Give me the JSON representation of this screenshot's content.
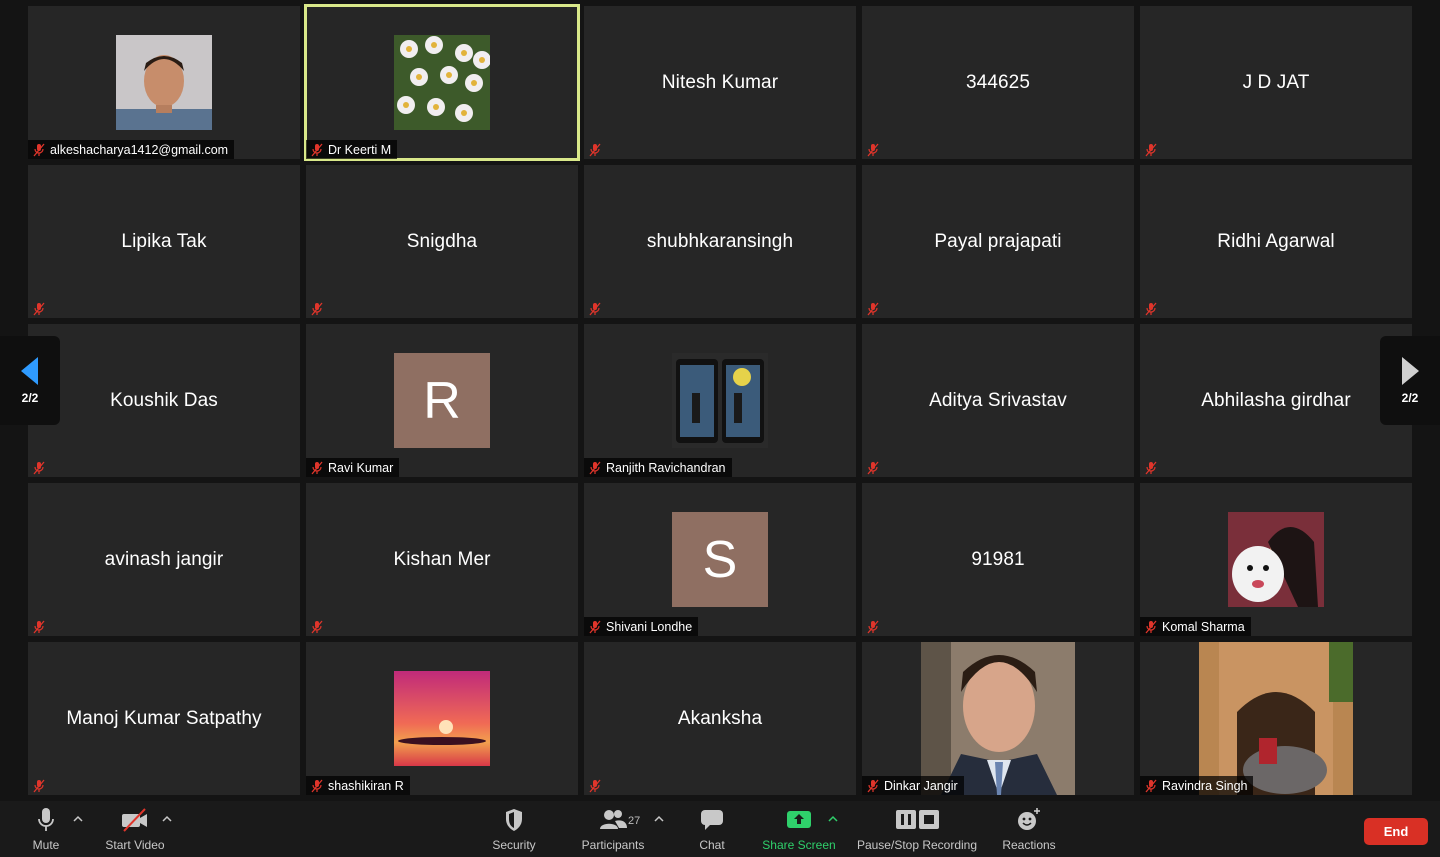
{
  "participants": [
    {
      "name": "alkeshacharya1412@gmail.com",
      "type": "photo",
      "photo": "man-portrait",
      "label": "alkeshacharya1412@gmail.com"
    },
    {
      "name": "Dr Keerti M",
      "type": "photo",
      "photo": "daisies",
      "label": "Dr Keerti M",
      "active": true
    },
    {
      "name": "Nitesh Kumar",
      "type": "text",
      "label": ""
    },
    {
      "name": "344625",
      "type": "text",
      "label": ""
    },
    {
      "name": "J D JAT",
      "type": "text",
      "label": ""
    },
    {
      "name": "Lipika Tak",
      "type": "text",
      "label": ""
    },
    {
      "name": "Snigdha",
      "type": "text",
      "label": ""
    },
    {
      "name": "shubhkaransingh",
      "type": "text",
      "label": ""
    },
    {
      "name": "Payal prajapati",
      "type": "text",
      "label": ""
    },
    {
      "name": "Ridhi Agarwal",
      "type": "text",
      "label": ""
    },
    {
      "name": "Koushik Das",
      "type": "text",
      "label": ""
    },
    {
      "name": "Ravi Kumar",
      "type": "letter",
      "letter": "R",
      "label": "Ravi Kumar"
    },
    {
      "name": "Ranjith Ravichandran",
      "type": "photo",
      "photo": "couple-phones",
      "label": "Ranjith Ravichandran"
    },
    {
      "name": "Aditya Srivastav",
      "type": "text",
      "label": ""
    },
    {
      "name": "Abhilasha girdhar",
      "type": "text",
      "label": ""
    },
    {
      "name": "avinash jangir",
      "type": "text",
      "label": ""
    },
    {
      "name": "Kishan Mer",
      "type": "text",
      "label": ""
    },
    {
      "name": "Shivani Londhe",
      "type": "letter",
      "letter": "S",
      "label": "Shivani Londhe"
    },
    {
      "name": "91981",
      "type": "text",
      "label": ""
    },
    {
      "name": "Komal Sharma",
      "type": "photo",
      "photo": "girl-with-dog",
      "label": "Komal Sharma"
    },
    {
      "name": "Manoj Kumar Satpathy",
      "type": "text",
      "label": ""
    },
    {
      "name": "shashikiran R",
      "type": "photo",
      "photo": "sunset",
      "label": "shashikiran R"
    },
    {
      "name": "Akanksha",
      "type": "text",
      "label": ""
    },
    {
      "name": "Dinkar Jangir",
      "type": "video",
      "photo": "man-video",
      "label": "Dinkar Jangir"
    },
    {
      "name": "Ravindra Singh",
      "type": "video",
      "photo": "elephant-gate",
      "label": "Ravindra Singh"
    }
  ],
  "pager": {
    "left": "2/2",
    "right": "2/2"
  },
  "toolbar": {
    "mute": "Mute",
    "start_video": "Start Video",
    "security": "Security",
    "participants": "Participants",
    "participants_count": "27",
    "chat": "Chat",
    "share_screen": "Share Screen",
    "recording": "Pause/Stop Recording",
    "reactions": "Reactions",
    "end": "End"
  },
  "colors": {
    "tile_bg": "#262626",
    "active_border": "#d9e88a",
    "share_green": "#2fd06b",
    "end_red": "#d93025",
    "muted_red": "#e0352b",
    "letter_avatar": "#8f6f62"
  }
}
